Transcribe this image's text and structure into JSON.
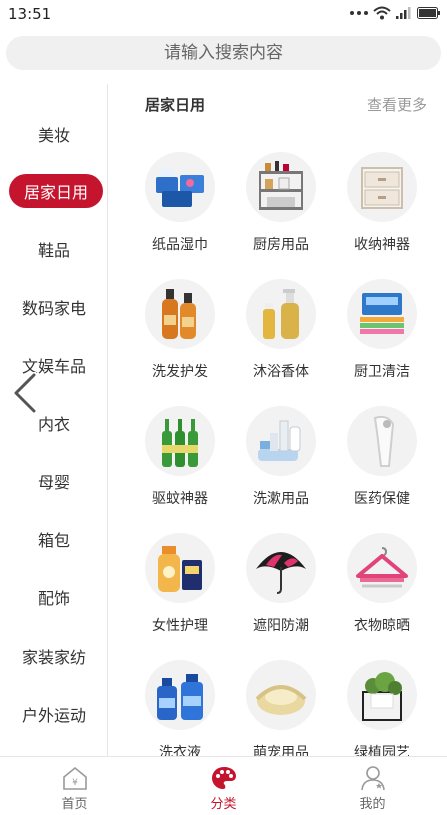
{
  "status_bar": {
    "time": "13:51"
  },
  "search": {
    "placeholder": "请输入搜索内容"
  },
  "sidebar": {
    "items": [
      {
        "label": "美妆",
        "active": false
      },
      {
        "label": "居家日用",
        "active": true
      },
      {
        "label": "鞋品",
        "active": false
      },
      {
        "label": "数码家电",
        "active": false
      },
      {
        "label": "文娱车品",
        "active": false
      },
      {
        "label": "内衣",
        "active": false
      },
      {
        "label": "母婴",
        "active": false
      },
      {
        "label": "箱包",
        "active": false
      },
      {
        "label": "配饰",
        "active": false
      },
      {
        "label": "家装家纺",
        "active": false
      },
      {
        "label": "户外运动",
        "active": false
      }
    ]
  },
  "main": {
    "heading": "居家日用",
    "more_link": "查看更多",
    "items": [
      {
        "label": "纸品湿巾",
        "icon": "tissue-pack-icon"
      },
      {
        "label": "厨房用品",
        "icon": "kitchen-rack-icon"
      },
      {
        "label": "收纳神器",
        "icon": "storage-drawer-icon"
      },
      {
        "label": "洗发护发",
        "icon": "shampoo-bottle-icon"
      },
      {
        "label": "沐浴香体",
        "icon": "body-wash-icon"
      },
      {
        "label": "厨卫清洁",
        "icon": "cleaning-cloth-icon"
      },
      {
        "label": "驱蚊神器",
        "icon": "mosquito-repellent-icon"
      },
      {
        "label": "洗漱用品",
        "icon": "toiletries-icon"
      },
      {
        "label": "医药保健",
        "icon": "thermometer-icon"
      },
      {
        "label": "女性护理",
        "icon": "feminine-care-icon"
      },
      {
        "label": "遮阳防潮",
        "icon": "umbrella-icon"
      },
      {
        "label": "衣物晾晒",
        "icon": "clothes-hanger-icon"
      },
      {
        "label": "洗衣液",
        "icon": "laundry-detergent-icon"
      },
      {
        "label": "萌宠用品",
        "icon": "pet-bed-icon"
      },
      {
        "label": "绿植园艺",
        "icon": "potted-plant-icon"
      }
    ]
  },
  "tabbar": {
    "tabs": [
      {
        "label": "首页",
        "icon": "home-icon",
        "active": false
      },
      {
        "label": "分类",
        "icon": "palette-icon",
        "active": true
      },
      {
        "label": "我的",
        "icon": "user-icon",
        "active": false
      }
    ]
  },
  "colors": {
    "accent": "#c5152e",
    "muted": "#999999"
  }
}
